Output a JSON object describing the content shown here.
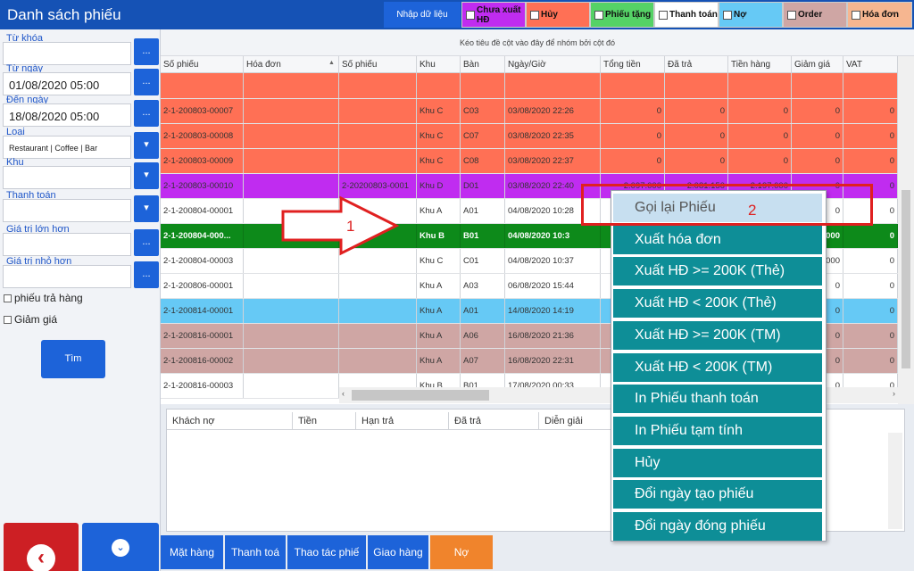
{
  "window": {
    "title": "Danh sách phiếu"
  },
  "toolbar": {
    "import_label": "Nhập dữ liệu"
  },
  "legend": [
    {
      "label": "Chưa xuất HĐ",
      "color": "#c02cf0"
    },
    {
      "label": "Hủy",
      "color": "#ff7055"
    },
    {
      "label": "Phiếu tặng",
      "color": "#55d266"
    },
    {
      "label": "Thanh toán",
      "color": "#ffffff"
    },
    {
      "label": "Nợ",
      "color": "#66c9f5"
    },
    {
      "label": "Order",
      "color": "#cfa6a4"
    },
    {
      "label": "Hóa đơn",
      "color": "#f6b690"
    }
  ],
  "filters": {
    "keyword": {
      "label": "Từ khóa",
      "value": "",
      "btn": "..."
    },
    "from_date": {
      "label": "Từ ngày",
      "value": "01/08/2020 05:00",
      "btn": "..."
    },
    "to_date": {
      "label": "Đến ngày",
      "value": "18/08/2020 05:00",
      "btn": "..."
    },
    "type": {
      "label": "Loại",
      "value": "Restaurant | Coffee | Bar"
    },
    "area": {
      "label": "Khu",
      "value": ""
    },
    "payment": {
      "label": "Thanh toán",
      "value": ""
    },
    "greater": {
      "label": "Giá trị lớn hơn",
      "value": "",
      "btn": "..."
    },
    "smaller": {
      "label": "Giá trị nhỏ hơn",
      "value": "",
      "btn": "..."
    },
    "return_check": "phiếu trả hàng",
    "discount_check": "Giảm giá",
    "search_button": "Tìm"
  },
  "grid": {
    "group_hint": "Kéo tiêu đề cột vào đây để nhóm bởi cột đó",
    "columns": [
      "Số phiếu",
      "Hóa đơn",
      "Số phiếu",
      "Khu",
      "Bàn",
      "Ngày/Giờ",
      "Tổng tiền",
      "Đã trả",
      "Tiền hàng",
      "Giảm giá",
      "VAT"
    ],
    "rows": [
      {
        "cells": [
          "",
          "",
          "",
          "",
          "",
          "",
          "",
          "",
          "",
          "",
          ""
        ],
        "color": "#ff7055"
      },
      {
        "cells": [
          "2-1-200803-00007",
          "",
          "",
          "Khu C",
          "C03",
          "03/08/2020 22:26",
          "0",
          "0",
          "0",
          "0",
          "0"
        ],
        "color": "#ff7055"
      },
      {
        "cells": [
          "2-1-200803-00008",
          "",
          "",
          "Khu C",
          "C07",
          "03/08/2020 22:35",
          "0",
          "0",
          "0",
          "0",
          "0"
        ],
        "color": "#ff7055"
      },
      {
        "cells": [
          "2-1-200803-00009",
          "",
          "",
          "Khu C",
          "C08",
          "03/08/2020 22:37",
          "0",
          "0",
          "0",
          "0",
          "0"
        ],
        "color": "#ff7055"
      },
      {
        "cells": [
          "2-1-200803-00010",
          "",
          "2-20200803-0001",
          "Khu D",
          "D01",
          "03/08/2020 22:40",
          "2.097.000",
          "2.081.150",
          "2.197.000",
          "0",
          "0"
        ],
        "color": "#c02cf0"
      },
      {
        "cells": [
          "2-1-200804-00001",
          "",
          "",
          "Khu A",
          "A01",
          "04/08/2020 10:28",
          "",
          "",
          "",
          "0",
          "0"
        ],
        "color": "#ffffff"
      },
      {
        "cells": [
          "2-1-200804-000...",
          "",
          "",
          "Khu B",
          "B01",
          "04/08/2020 10:3",
          "",
          "",
          "",
          "000",
          "0"
        ],
        "color": "#0d8a1a",
        "bold": true
      },
      {
        "cells": [
          "2-1-200804-00003",
          "",
          "",
          "Khu C",
          "C01",
          "04/08/2020 10:37",
          "",
          "",
          "",
          ",000",
          "0"
        ],
        "color": "#ffffff"
      },
      {
        "cells": [
          "2-1-200806-00001",
          "",
          "",
          "Khu A",
          "A03",
          "06/08/2020 15:44",
          "",
          "",
          "",
          "0",
          "0"
        ],
        "color": "#ffffff"
      },
      {
        "cells": [
          "2-1-200814-00001",
          "",
          "",
          "Khu A",
          "A01",
          "14/08/2020 14:19",
          "",
          "",
          "",
          "0",
          "0"
        ],
        "color": "#66c9f5"
      },
      {
        "cells": [
          "2-1-200816-00001",
          "",
          "",
          "Khu A",
          "A06",
          "16/08/2020 21:36",
          "",
          "",
          "",
          "0",
          "0"
        ],
        "color": "#cfa6a4"
      },
      {
        "cells": [
          "2-1-200816-00002",
          "",
          "",
          "Khu A",
          "A07",
          "16/08/2020 22:31",
          "",
          "",
          "",
          "0",
          "0"
        ],
        "color": "#cfa6a4"
      },
      {
        "cells": [
          "2-1-200816-00003",
          "",
          "",
          "Khu B",
          "B01",
          "17/08/2020 00:33",
          "",
          "",
          "",
          "0",
          "0"
        ],
        "color": "#ffffff"
      }
    ]
  },
  "debt_grid": {
    "columns": [
      "Khách nợ",
      "Tiền",
      "Hạn trả",
      "Đã trả",
      "Diễn giải"
    ]
  },
  "bottom_tabs": [
    "Mặt hàng",
    "Thanh toá",
    "Thao tác phiế",
    "Giao hàng",
    "Nợ"
  ],
  "context_menu": [
    "Gọi lại Phiếu",
    "Xuất hóa đơn",
    "Xuất HĐ >= 200K (Thẻ)",
    "Xuất HĐ < 200K (Thẻ)",
    "Xuất HĐ >= 200K (TM)",
    "Xuất HĐ < 200K (TM)",
    "In Phiếu thanh toán",
    "In Phiếu tạm tính",
    "Hủy",
    "Đổi ngày tạo phiếu",
    "Đổi ngày đóng phiếu"
  ],
  "annotations": {
    "step1": "1",
    "step2": "2",
    "highlight_color": "#e02020"
  }
}
